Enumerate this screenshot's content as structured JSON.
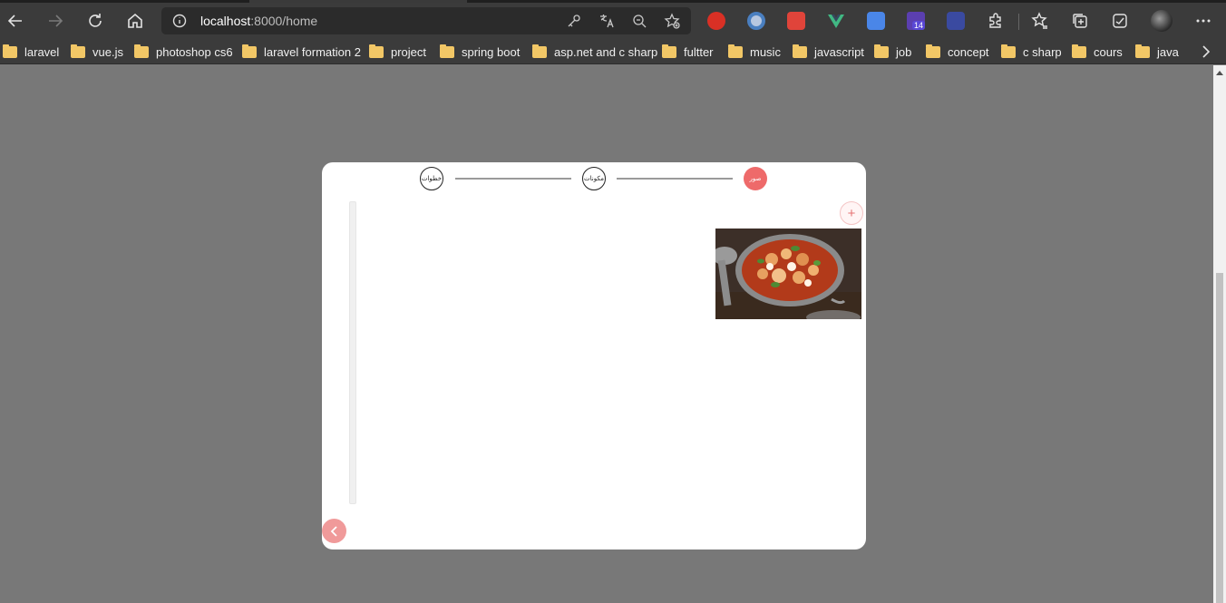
{
  "browser": {
    "url_host": "localhost",
    "url_rest": ":8000/home",
    "extension_badge": "14"
  },
  "bookmarks": [
    "laravel",
    "vue.js",
    "photoshop cs6",
    "laravel formation 2",
    "project",
    "spring boot",
    "asp.net and c sharp",
    "fultter",
    "music",
    "javascript",
    "job",
    "concept",
    "c sharp",
    "cours",
    "java"
  ],
  "wizard": {
    "steps": [
      {
        "label": "خطوات",
        "state": "pending"
      },
      {
        "label": "مكونات",
        "state": "pending"
      },
      {
        "label": "صور",
        "state": "active"
      }
    ],
    "add_label": "+"
  },
  "colors": {
    "accent": "#ee6a6a",
    "accent_light": "#f09a9a",
    "page_bg": "#787878",
    "card_bg": "#ffffff"
  }
}
